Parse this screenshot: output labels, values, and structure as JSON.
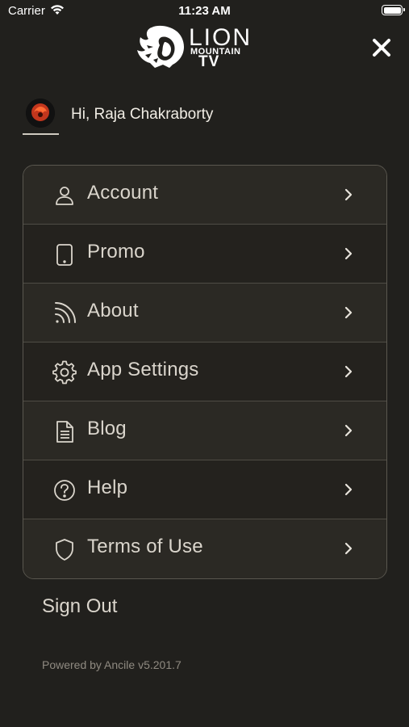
{
  "status_bar": {
    "carrier": "Carrier",
    "time": "11:23 AM"
  },
  "brand": {
    "line1": "LION",
    "line2": "MOUNTAIN",
    "line3": "TV"
  },
  "profile": {
    "greeting": "Hi, Raja Chakraborty"
  },
  "menu": {
    "items": [
      {
        "label": "Account",
        "icon": "user-icon"
      },
      {
        "label": "Promo",
        "icon": "tablet-icon"
      },
      {
        "label": "About",
        "icon": "rss-icon"
      },
      {
        "label": "App Settings",
        "icon": "gear-icon"
      },
      {
        "label": "Blog",
        "icon": "document-icon"
      },
      {
        "label": "Help",
        "icon": "help-circle-icon"
      },
      {
        "label": "Terms of Use",
        "icon": "shield-icon"
      }
    ]
  },
  "sign_out_label": "Sign Out",
  "footer": {
    "powered_by": "Powered by Ancile v5.201.7"
  },
  "colors": {
    "background": "#21201d",
    "menu_border": "#5a574f",
    "text": "#dad5cc",
    "muted": "#8f8a81"
  }
}
